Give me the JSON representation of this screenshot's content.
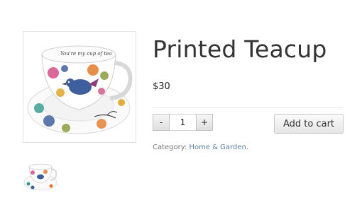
{
  "product": {
    "title": "Printed Teacup",
    "price": "$30",
    "image_alt": "Printed teacup and saucer",
    "cup_inscription": "You're my cup of tea",
    "quantity": {
      "decrease_label": "-",
      "value": "1",
      "increase_label": "+"
    },
    "add_to_cart_label": "Add to cart",
    "meta": {
      "category_label": "Category:",
      "category_link": "Home & Garden",
      "trailing": "."
    }
  },
  "colors": {
    "link": "#5b7fa8",
    "bird_blue": "#3f5f9c",
    "flower_pink": "#d14f86",
    "flower_orange": "#e07a2a",
    "flower_teal": "#2f9a8c"
  }
}
